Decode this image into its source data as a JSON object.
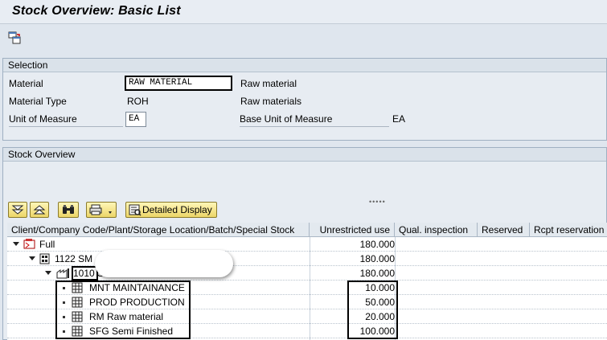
{
  "title": "Stock Overview: Basic List",
  "selection": {
    "header": "Selection",
    "material_label": "Material",
    "material_value": "RAW MATERIAL",
    "material_desc": "Raw material",
    "type_label": "Material Type",
    "type_value": "ROH",
    "type_desc": "Raw materials",
    "uom_label": "Unit of Measure",
    "uom_value": "EA",
    "base_uom_label": "Base Unit of Measure",
    "base_uom_value": "EA"
  },
  "stock": {
    "header": "Stock Overview",
    "detail_button": "Detailed Display",
    "columns": [
      "Client/Company Code/Plant/Storage Location/Batch/Special Stock",
      "Unrestricted use",
      "Qual. inspection",
      "Reserved",
      "Rcpt reservation"
    ],
    "rows": [
      {
        "label": "Full",
        "value": "180.000"
      },
      {
        "label": "1122 SM",
        "value": "180.000"
      },
      {
        "label": "1010 S",
        "value": "180.000"
      },
      {
        "label": "MNT MAINTAINANCE",
        "value": "10.000"
      },
      {
        "label": "PROD PRODUCTION",
        "value": "50.000"
      },
      {
        "label": "RM Raw material",
        "value": "20.000"
      },
      {
        "label": "SFG Semi Finished",
        "value": "100.000"
      }
    ]
  },
  "icons": {
    "toolbar": "multi-window-icon",
    "expand": "expand-all-icon",
    "collapse": "collapse-all-icon",
    "find": "binoculars-icon",
    "print": "printer-icon",
    "detail": "detail-display-icon",
    "client": "client-node-icon",
    "company": "company-code-icon",
    "plant": "plant-icon",
    "storage": "storage-location-icon"
  }
}
